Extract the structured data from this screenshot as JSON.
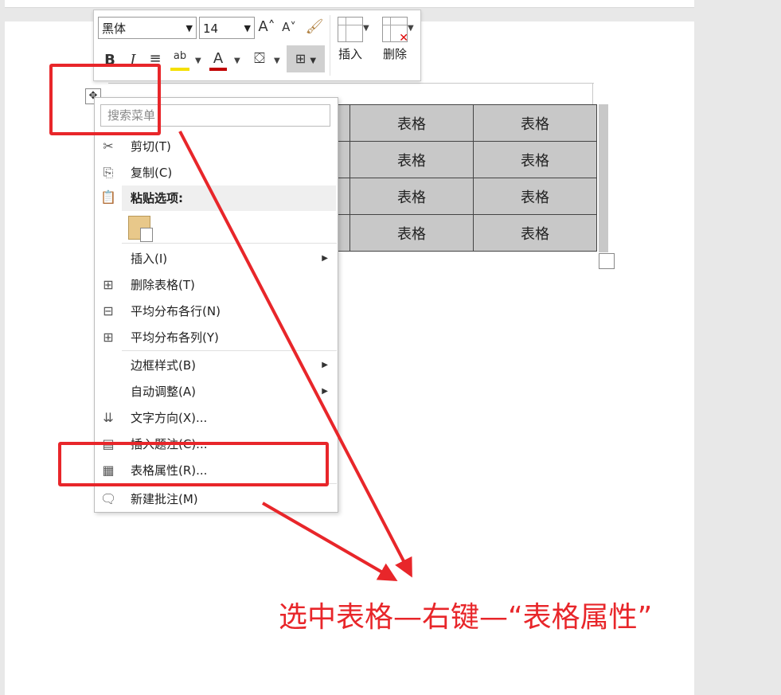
{
  "mini_toolbar": {
    "font_name": "黑体",
    "font_size": "14",
    "grow_font_icon": "A˄",
    "shrink_font_icon": "A˅",
    "bold": "B",
    "italic": "I",
    "font_color_letter": "A",
    "insert_label": "插入",
    "delete_label": "删除"
  },
  "table": {
    "rows": [
      [
        "",
        "表格",
        "表格"
      ],
      [
        "",
        "表格",
        "表格"
      ],
      [
        "",
        "表格",
        "表格"
      ],
      [
        "",
        "表格",
        "表格"
      ]
    ]
  },
  "context_menu": {
    "search_placeholder": "搜索菜单",
    "cut": "剪切(T)",
    "copy": "复制(C)",
    "paste_options": "粘贴选项:",
    "insert": "插入(I)",
    "delete_table": "删除表格(T)",
    "distribute_rows": "平均分布各行(N)",
    "distribute_cols": "平均分布各列(Y)",
    "border_styles": "边框样式(B)",
    "autofit": "自动调整(A)",
    "text_direction": "文字方向(X)...",
    "insert_caption": "插入题注(C)...",
    "table_properties": "表格属性(R)...",
    "new_comment": "新建批注(M)"
  },
  "annotation": {
    "caption": "选中表格—右键—“表格属性”",
    "color": "#e8262a"
  }
}
